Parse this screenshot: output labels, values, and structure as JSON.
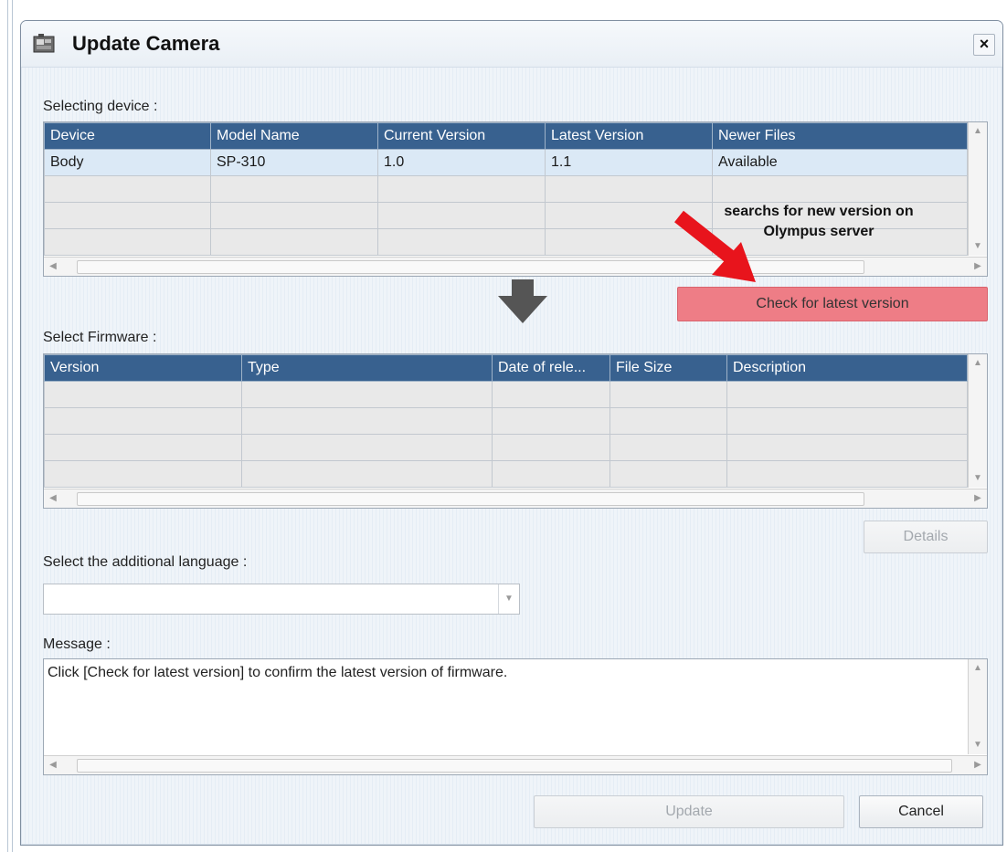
{
  "window": {
    "title": "Update Camera",
    "close_label": "×"
  },
  "device_section": {
    "label": "Selecting device :",
    "columns": [
      "Device",
      "Model Name",
      "Current Version",
      "Latest Version",
      "Newer Files"
    ],
    "rows": [
      [
        "Body",
        "SP-310",
        "1.0",
        "1.1",
        "Available"
      ]
    ]
  },
  "annotation": {
    "line1": "searchs for new version on",
    "line2": "Olympus server",
    "arrow_color": "#e8141c"
  },
  "check_button": {
    "label": "Check for latest version",
    "color": "#ee7d86"
  },
  "firmware_section": {
    "label": "Select Firmware :",
    "columns": [
      "Version",
      "Type",
      "Date of rele...",
      "File Size",
      "Description"
    ],
    "rows": []
  },
  "details_button": {
    "label": "Details"
  },
  "language_section": {
    "label": "Select the additional language :",
    "selected": ""
  },
  "message_section": {
    "label": "Message :",
    "text": "Click [Check for latest version] to confirm the latest version of firmware."
  },
  "footer": {
    "update_label": "Update",
    "cancel_label": "Cancel"
  },
  "colors": {
    "header_bg": "#38618f",
    "selected_row": "#dbe9f6"
  }
}
